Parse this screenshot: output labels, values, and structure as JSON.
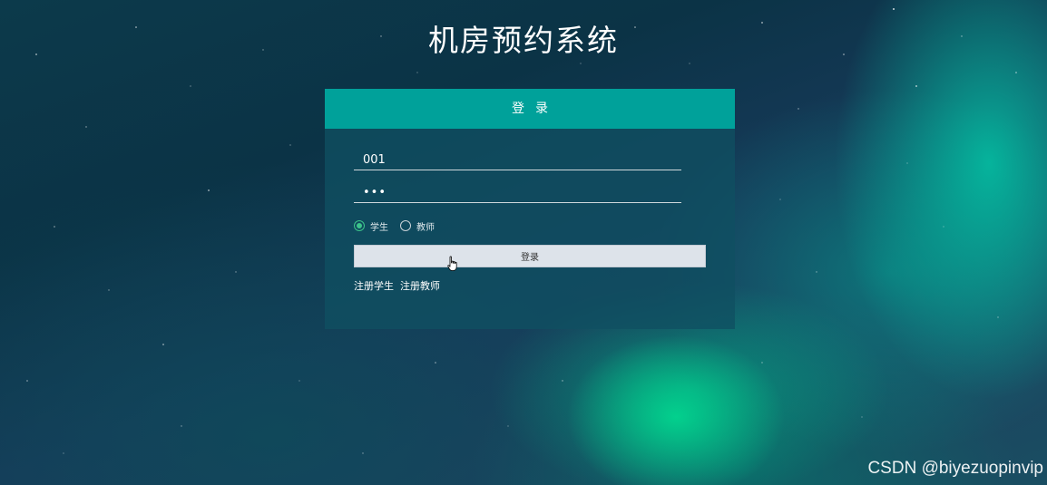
{
  "title": "机房预约系统",
  "login_panel": {
    "header": "登录",
    "account_value": "001",
    "password_value": "•••",
    "roles": [
      {
        "label": "学生",
        "checked": true
      },
      {
        "label": "教师",
        "checked": false
      }
    ],
    "submit_label": "登录",
    "links": [
      {
        "label": "注册学生"
      },
      {
        "label": "注册教师"
      }
    ]
  },
  "watermark": "CSDN @biyezuopinvip",
  "colors": {
    "header_bg": "#00a19a",
    "radio_checked": "#3cc48a",
    "button_bg": "#dde3ea"
  }
}
